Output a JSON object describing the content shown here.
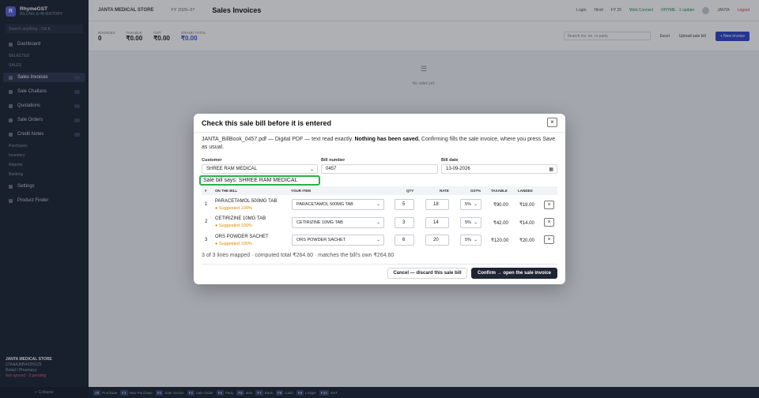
{
  "sidebar": {
    "brand_name": "RhymeGST",
    "brand_sub": "BILLING & INVENTORY",
    "search": "Search anything · Ctrl K",
    "items": [
      {
        "label": "Dashboard"
      },
      {
        "label": "Sales Invoices"
      },
      {
        "label": "Sale Challans"
      },
      {
        "label": "Quotations"
      },
      {
        "label": "Sale Orders"
      },
      {
        "label": "Credit Notes"
      },
      {
        "label": "Settings"
      },
      {
        "label": "Product Finder"
      }
    ],
    "sections": [
      "SELECTED",
      "SALES",
      "Purchases",
      "Inventory",
      "Reports",
      "Banking"
    ],
    "footer_shop": "JANTA MEDICAL STORE",
    "footer_gst": "27AAAJM5432N1Z5",
    "footer_status": "Retail / Pharmacy",
    "footer_sync": "Not synced · 0 pending",
    "collapse": "« Collapse"
  },
  "topbar": {
    "store": "JANTA MEDICAL STORE",
    "fy": "FY 2026–27",
    "title": "Sales Invoices",
    "login": "Login",
    "lang": "Hindi",
    "online": "Web Connect",
    "fys": "FY 25",
    "status": "RHYME · 1 update",
    "user": "JANTA",
    "logout": "Logout"
  },
  "stats": [
    {
      "label": "INVOICES",
      "value": "0"
    },
    {
      "label": "TAXABLE",
      "value": "₹0.00"
    },
    {
      "label": "GST",
      "value": "₹0.00"
    },
    {
      "label": "GRAND TOTAL",
      "value": "₹0.00"
    }
  ],
  "statsbar": {
    "search_placeholder": "Search inv. no. or party",
    "export": "Excel",
    "import_btn": "Upload sale bill",
    "new_btn": "+ New invoice"
  },
  "empty_state": "No sales yet.",
  "bottom_shortcuts": [
    {
      "key": "Alt",
      "label": "Purchase"
    },
    {
      "key": "F2",
      "label": "New Purchase"
    },
    {
      "key": "F3",
      "label": "Sale Invoice"
    },
    {
      "key": "F4",
      "label": "Sale Order"
    },
    {
      "key": "F5",
      "label": "Party"
    },
    {
      "key": "F6",
      "label": "Item"
    },
    {
      "key": "F7",
      "label": "Bank"
    },
    {
      "key": "F8",
      "label": "Cash"
    },
    {
      "key": "F9",
      "label": "Ledger"
    },
    {
      "key": "F10",
      "label": "GST"
    }
  ],
  "modal": {
    "title": "Check this sale bill before it is entered",
    "intro_file": "JANTA_BillBook_0457.pdf — Digital PDF — text read exactly.",
    "intro_bold": "Nothing has been saved.",
    "intro_rest": "Confirming fills the sale invoice, where you press Save as usual.",
    "customer_label": "Customer",
    "customer_value": "SHREE RAM MEDICAL",
    "bill_number_label": "Bill number",
    "bill_number_value": "0457",
    "bill_date_label": "Bill date",
    "bill_date_value": "13-09-2026",
    "sale_bill_says": "Sale bill says: SHREE RAM MEDICAL",
    "columns": {
      "num": "#",
      "on_bill": "ON THE BILL",
      "your_item": "YOUR ITEM",
      "qty": "QTY",
      "rate": "RATE",
      "gst": "GST%",
      "taxable": "TAXABLE",
      "landed": "LANDED"
    },
    "rows": [
      {
        "num": "1",
        "bill_name": "PARACETAMOL 500MG TAB",
        "suggestion": "● Suggested 100%",
        "item": "PARACETAMOL 500MG TAB",
        "qty": "5",
        "rate": "18",
        "gst": "5%",
        "taxable": "₹90.00",
        "landed": "₹18.00"
      },
      {
        "num": "2",
        "bill_name": "CETIRIZINE 10MG TAB",
        "suggestion": "● Suggested 100%",
        "item": "CETIRIZINE 10MG TAB",
        "qty": "3",
        "rate": "14",
        "gst": "5%",
        "taxable": "₹42.00",
        "landed": "₹14.00"
      },
      {
        "num": "3",
        "bill_name": "ORS POWDER SACHET",
        "suggestion": "● Suggested 100%",
        "item": "ORS POWDER SACHET",
        "qty": "6",
        "rate": "20",
        "gst": "5%",
        "taxable": "₹120.00",
        "landed": "₹20.00"
      }
    ],
    "summary": "3 of 3 lines mapped · computed total ₹264.60 · matches the bill's own ₹264.60",
    "cancel_label": "Cancel — discard this sale bill",
    "confirm_label": "Confirm → open the sale invoice"
  }
}
